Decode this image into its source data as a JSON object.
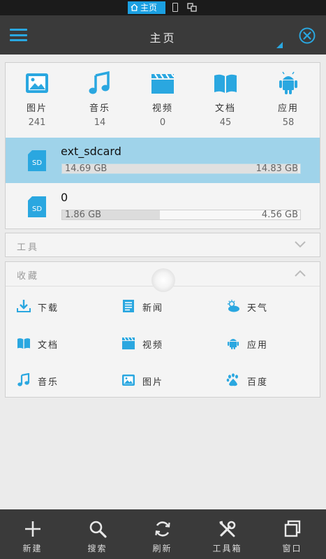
{
  "status_bar": {
    "tab_label": "主页"
  },
  "header": {
    "title": "主页"
  },
  "categories": [
    {
      "label": "图片",
      "count": "241",
      "icon": "image-icon"
    },
    {
      "label": "音乐",
      "count": "14",
      "icon": "music-icon"
    },
    {
      "label": "视频",
      "count": "0",
      "icon": "video-icon"
    },
    {
      "label": "文档",
      "count": "45",
      "icon": "document-icon"
    },
    {
      "label": "应用",
      "count": "58",
      "icon": "android-icon"
    }
  ],
  "storage": [
    {
      "icon_text": "SD",
      "name": "ext_sdcard",
      "used": "14.69 GB",
      "total": "14.83 GB",
      "fill_fraction": 0.99,
      "selected": true
    },
    {
      "icon_text": "SD",
      "name": "0",
      "used": "1.86 GB",
      "total": "4.56 GB",
      "fill_fraction": 0.41,
      "selected": false
    }
  ],
  "tools": {
    "label": "工具"
  },
  "favorites": {
    "label": "收藏",
    "items": [
      {
        "label": "下载",
        "icon": "download-icon"
      },
      {
        "label": "新闻",
        "icon": "news-icon"
      },
      {
        "label": "天气",
        "icon": "weather-icon"
      },
      {
        "label": "文档",
        "icon": "document-icon"
      },
      {
        "label": "视频",
        "icon": "video-icon"
      },
      {
        "label": "应用",
        "icon": "android-icon"
      },
      {
        "label": "音乐",
        "icon": "music-icon"
      },
      {
        "label": "图片",
        "icon": "image-icon"
      },
      {
        "label": "百度",
        "icon": "baidu-icon"
      }
    ]
  },
  "bottom_bar": [
    {
      "label": "新建",
      "icon": "plus-icon"
    },
    {
      "label": "搜索",
      "icon": "search-icon"
    },
    {
      "label": "刷新",
      "icon": "refresh-icon"
    },
    {
      "label": "工具箱",
      "icon": "tools-icon"
    },
    {
      "label": "窗口",
      "icon": "windows-icon"
    }
  ],
  "colors": {
    "accent": "#2aa7e0",
    "selected_row": "#9fd3ea",
    "bar_bg": "#3a3a3a"
  }
}
